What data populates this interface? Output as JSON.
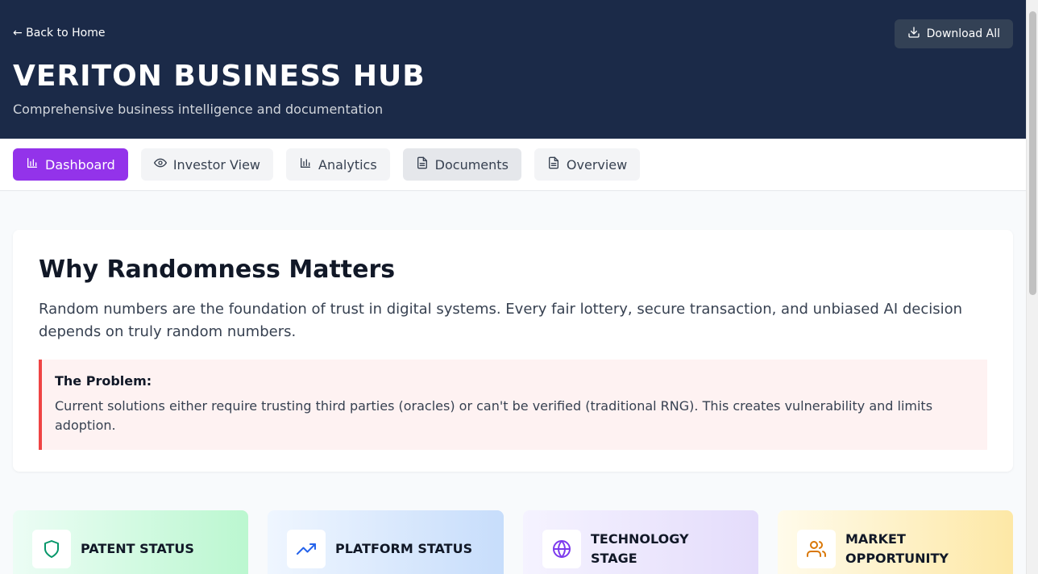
{
  "header": {
    "back_link": "← Back to Home",
    "download_label": "Download All",
    "title": "VERITON BUSINESS HUB",
    "subtitle": "Comprehensive business intelligence and documentation"
  },
  "tabs": [
    {
      "label": "Dashboard",
      "icon": "bar-chart-icon",
      "active": true
    },
    {
      "label": "Investor View",
      "icon": "eye-icon",
      "active": false
    },
    {
      "label": "Analytics",
      "icon": "bar-chart-icon",
      "active": false
    },
    {
      "label": "Documents",
      "icon": "document-icon",
      "active": false
    },
    {
      "label": "Overview",
      "icon": "document-icon",
      "active": false
    }
  ],
  "main": {
    "title": "Why Randomness Matters",
    "text": "Random numbers are the foundation of trust in digital systems. Every fair lottery, secure transaction, and unbiased AI decision depends on truly random numbers.",
    "problem": {
      "title": "The Problem:",
      "text": "Current solutions either require trusting third parties (oracles) or can't be verified (traditional RNG). This creates vulnerability and limits adoption."
    }
  },
  "stats": [
    {
      "label": "PATENT STATUS",
      "icon": "shield-icon"
    },
    {
      "label": "PLATFORM STATUS",
      "icon": "trending-up-icon"
    },
    {
      "label": "TECHNOLOGY STAGE",
      "icon": "globe-icon"
    },
    {
      "label": "MARKET OPPORTUNITY",
      "icon": "users-icon"
    }
  ],
  "colors": {
    "header_bg": "#1b2a48",
    "accent": "#9333ea",
    "problem_border": "#ef4444"
  }
}
